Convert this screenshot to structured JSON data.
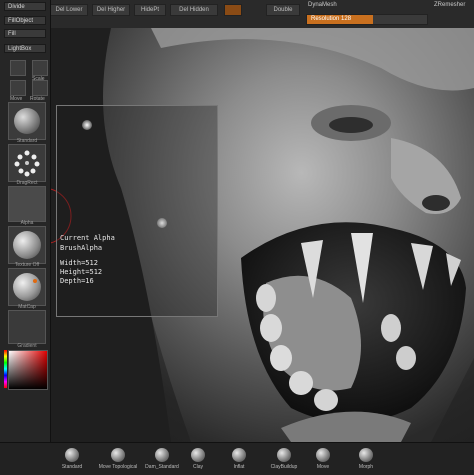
{
  "top_shelf": {
    "buttons": [
      "Divide",
      "Del Lower",
      "Del Higher",
      "HidePt",
      "Del Hidden",
      "Double"
    ],
    "dynamesh_label": "DynaMesh",
    "resolution_label": "Resolution 128",
    "resolution_value": 0.55,
    "zremesher_label": "ZRemesher"
  },
  "left_tray": {
    "buttons": [
      "Divide",
      "FillObject",
      "Fill",
      "LightBox"
    ],
    "scale_label": "Scale",
    "move_label": "Move",
    "rotate_label": "Rotate",
    "brush_label": "Standard",
    "stroke_label": "DragRect",
    "alpha_label": "Alpha",
    "texture_label": "Texture Off",
    "material_label": "MatCap",
    "gradient_label": "Gradient"
  },
  "alpha_popup": {
    "title": "Current Alpha",
    "name": "BrushAlpha",
    "width": "Width=512",
    "height": "Height=512",
    "depth": "Depth=16"
  },
  "bottom_tray": {
    "brushes": [
      "Standard",
      "Move Topological",
      "Dam_Standard",
      "Clay",
      "Inflat",
      "ClayBuildup",
      "Move",
      "Morph"
    ]
  },
  "colors": {
    "accent": "#c9701f",
    "panel": "#262626",
    "background": "#1b1b1b"
  }
}
